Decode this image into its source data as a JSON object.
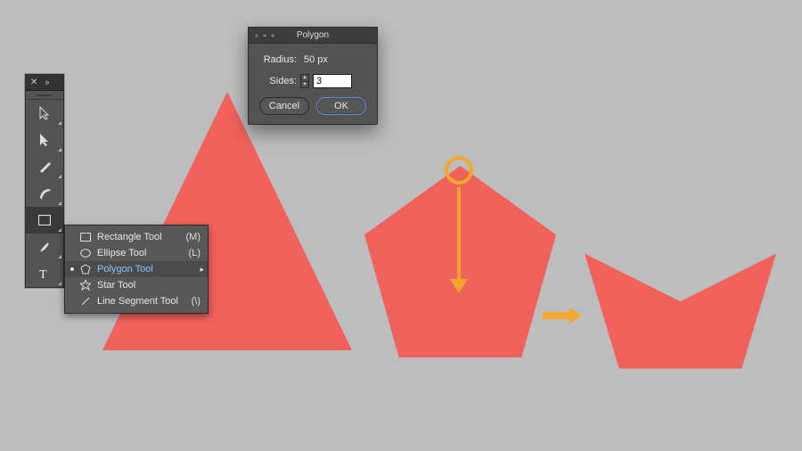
{
  "canvas": {
    "shape_color": "#f1625c",
    "accent_color": "#f3a72b"
  },
  "tool_panel": {
    "header": {
      "close": "✕",
      "expand": "»"
    },
    "tools": [
      {
        "name": "selection-tool"
      },
      {
        "name": "direct-selection-tool"
      },
      {
        "name": "pen-tool"
      },
      {
        "name": "curvature-tool"
      },
      {
        "name": "rectangle-tool",
        "active": true
      },
      {
        "name": "paintbrush-tool"
      },
      {
        "name": "type-tool"
      }
    ]
  },
  "flyout": {
    "items": [
      {
        "icon": "rect",
        "label": "Rectangle Tool",
        "shortcut": "(M)",
        "selected": false
      },
      {
        "icon": "circle",
        "label": "Ellipse Tool",
        "shortcut": "(L)",
        "selected": false
      },
      {
        "icon": "hex",
        "label": "Polygon Tool",
        "shortcut": "",
        "selected": true,
        "submenu": true
      },
      {
        "icon": "star",
        "label": "Star Tool",
        "shortcut": "",
        "selected": false
      },
      {
        "icon": "line",
        "label": "Line Segment Tool",
        "shortcut": "(\\)",
        "selected": false
      }
    ]
  },
  "dialog": {
    "title": "Polygon",
    "radius_label": "Radius:",
    "radius_value": "50 px",
    "sides_label": "Sides:",
    "sides_value": "3",
    "cancel": "Cancel",
    "ok": "OK"
  }
}
